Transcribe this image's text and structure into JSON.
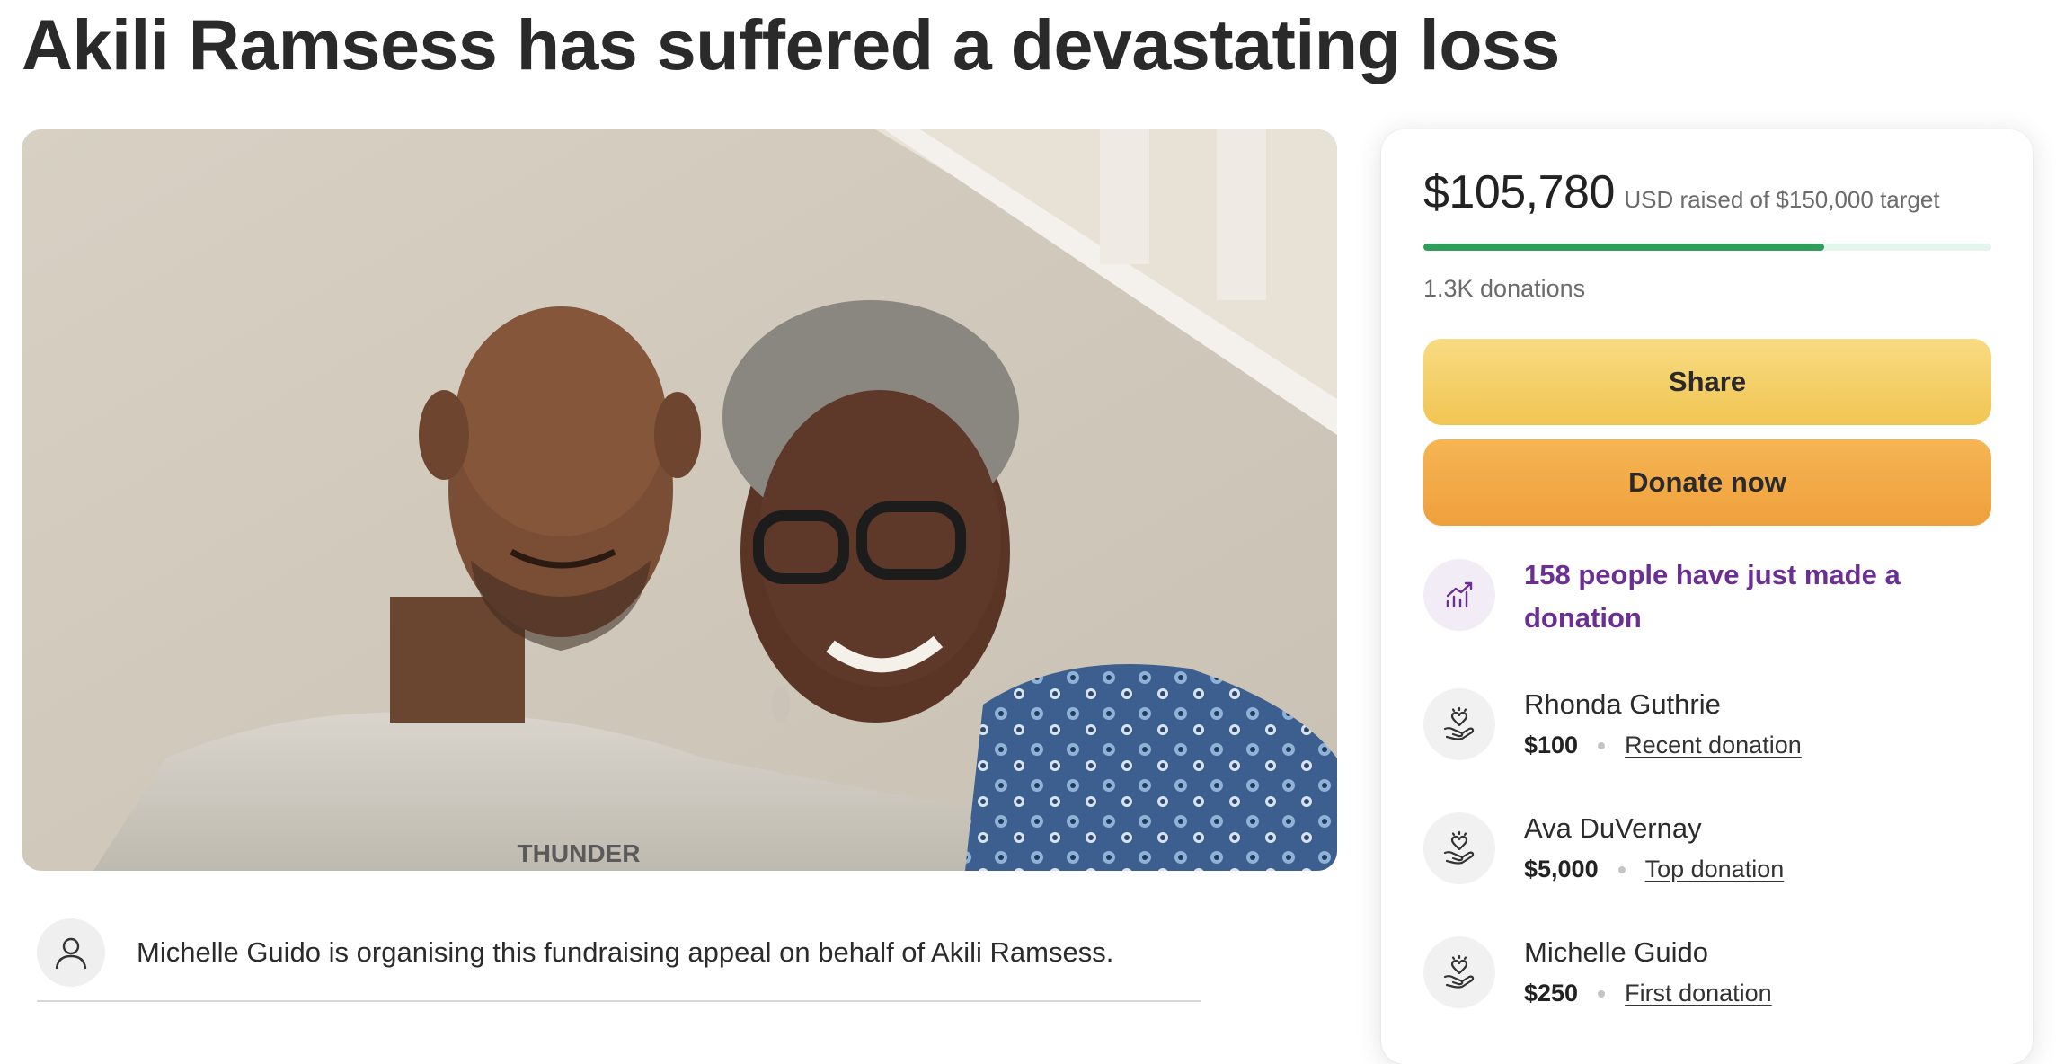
{
  "page": {
    "title": "Akili Ramsess has suffered a devastating loss"
  },
  "organiser": {
    "text": "Michelle Guido is organising this fundraising appeal on behalf of Akili Ramsess."
  },
  "sidebar": {
    "raised_amount": "$105,780",
    "raised_text": "USD raised of $150,000 target",
    "progress_fraction": 0.705,
    "donations_count": "1.3K donations",
    "share_label": "Share",
    "donate_label": "Donate now",
    "trend_text": "158 people have just made a donation",
    "donors": [
      {
        "name": "Rhonda Guthrie",
        "amount": "$100",
        "tag": "Recent donation"
      },
      {
        "name": "Ava DuVernay",
        "amount": "$5,000",
        "tag": "Top donation"
      },
      {
        "name": "Michelle Guido",
        "amount": "$250",
        "tag": "First donation"
      }
    ]
  },
  "colors": {
    "progress": "#2f9e5b",
    "share_button": "#f1c552",
    "donate_button": "#eea03c",
    "trend_text": "#6b2f93"
  },
  "icons": {
    "organiser": "user-icon",
    "trend": "trending-up-icon",
    "donor": "heart-hand-icon"
  }
}
